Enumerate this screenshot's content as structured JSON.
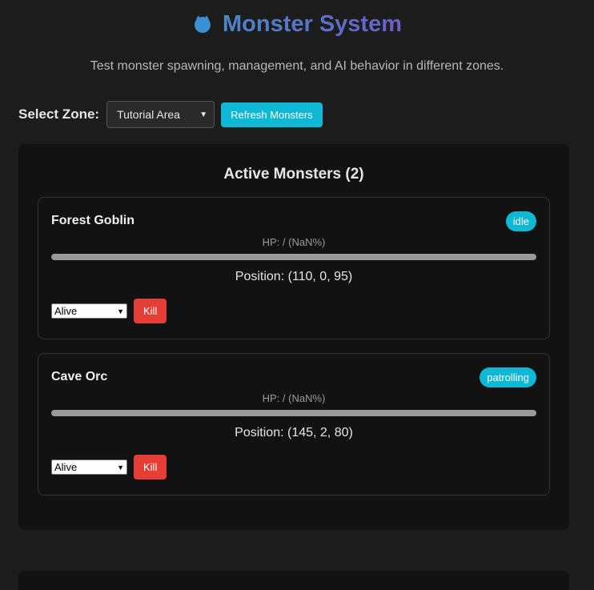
{
  "header": {
    "title": "Monster System",
    "icon": "monster-icon",
    "subtitle": "Test monster spawning, management, and AI behavior in different zones."
  },
  "controls": {
    "zone_label": "Select Zone:",
    "zone_selected": "Tutorial Area",
    "refresh_label": "Refresh Monsters"
  },
  "monsters_panel": {
    "title": "Active Monsters (2)",
    "monsters": [
      {
        "name": "Forest Goblin",
        "state": "idle",
        "hp_text": "HP: / (NaN%)",
        "position_text": "Position: (110, 0, 95)",
        "status_selected": "Alive",
        "kill_label": "Kill"
      },
      {
        "name": "Cave Orc",
        "state": "patrolling",
        "hp_text": "HP: / (NaN%)",
        "position_text": "Position: (145, 2, 80)",
        "status_selected": "Alive",
        "kill_label": "Kill"
      }
    ]
  },
  "colors": {
    "background": "#1c1c1c",
    "panel": "#121212",
    "accent": "#0fb8d4",
    "danger": "#e53e36",
    "title_gradient_start": "#4a86c8",
    "title_gradient_end": "#6a5fc9"
  }
}
